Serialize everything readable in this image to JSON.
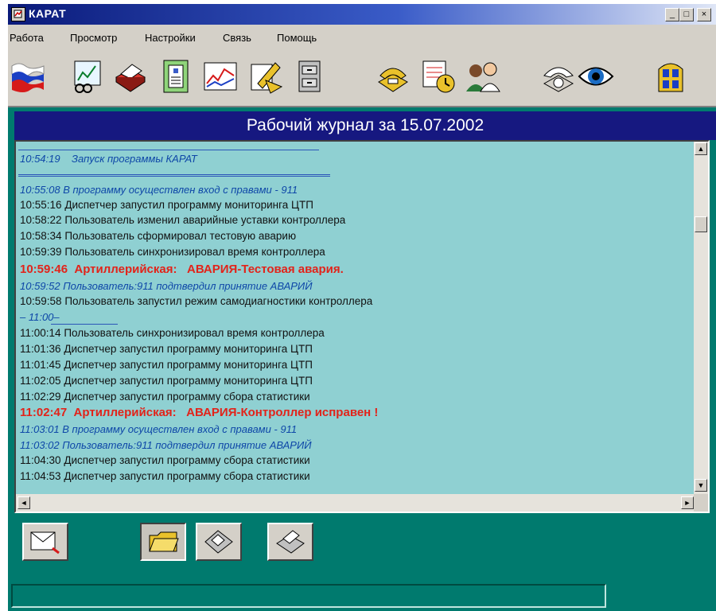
{
  "window": {
    "title": "КАРАТ",
    "min_glyph": "_",
    "max_glyph": "□",
    "close_glyph": "×"
  },
  "menu": {
    "items": [
      "Работа",
      "Просмотр",
      "Настройки",
      "Связь",
      "Помощь"
    ]
  },
  "toolbar": {
    "icons": [
      "russia-flag-icon",
      "chart-report-icon",
      "printer-icon",
      "document-icon",
      "graph-icon",
      "edit-pencil-icon",
      "file-cabinet-icon",
      "telephone-icon",
      "calendar-clock-icon",
      "users-icon",
      "rotary-phone-icon",
      "eye-icon",
      "building-icon"
    ]
  },
  "journal": {
    "title": "Рабочий журнал за 15.07.2002",
    "entries": [
      {
        "kind": "user",
        "time": "10:54:19",
        "text": "    Запуск программы КАРАТ"
      },
      {
        "kind": "user",
        "time": "10:55:08",
        "text": " В программу осуществлен вход с правами - 911"
      },
      {
        "kind": "normal",
        "time": "10:55:16",
        "text": " Диспетчер запустил программу мониторинга ЦТП"
      },
      {
        "kind": "normal",
        "time": "10:58:22",
        "text": " Пользователь изменил аварийные уставки контроллера"
      },
      {
        "kind": "normal",
        "time": "10:58:34",
        "text": " Пользователь сформировал тестовую аварию"
      },
      {
        "kind": "normal",
        "time": "10:59:39",
        "text": " Пользователь синхронизировал время контроллера"
      },
      {
        "kind": "alarm",
        "time": "10:59:46",
        "text": "  Артиллерийская:   АВАРИЯ-Тестовая авария."
      },
      {
        "kind": "user",
        "time": "10:59:52",
        "text": " Пользователь:911 подтвердил принятие АВАРИЙ"
      },
      {
        "kind": "normal",
        "time": "10:59:58",
        "text": " Пользователь запустил режим самодиагностики контроллера"
      },
      {
        "kind": "user",
        "time": "",
        "text": "– 11:00–"
      },
      {
        "kind": "normal",
        "time": "11:00:14",
        "text": " Пользователь синхронизировал время контроллера"
      },
      {
        "kind": "normal",
        "time": "11:01:36",
        "text": " Диспетчер запустил программу мониторинга ЦТП"
      },
      {
        "kind": "normal",
        "time": "11:01:45",
        "text": " Диспетчер запустил программу мониторинга ЦТП"
      },
      {
        "kind": "normal",
        "time": "11:02:05",
        "text": " Диспетчер запустил программу мониторинга ЦТП"
      },
      {
        "kind": "normal",
        "time": "11:02:29",
        "text": " Диспетчер запустил программу сбора статистики"
      },
      {
        "kind": "alarm",
        "time": "11:02:47",
        "text": "  Артиллерийская:   АВАРИЯ-Контроллер исправен !"
      },
      {
        "kind": "user",
        "time": "11:03:01",
        "text": " В программу осуществлен вход с правами - 911"
      },
      {
        "kind": "user",
        "time": "11:03:02",
        "text": " Пользователь:911 подтвердил принятие АВАРИЙ"
      },
      {
        "kind": "normal",
        "time": "11:04:30",
        "text": " Диспетчер запустил программу сбора статистики"
      },
      {
        "kind": "normal",
        "time": "11:04:53",
        "text": " Диспетчер запустил программу сбора статистики"
      }
    ]
  },
  "scroll": {
    "up": "▲",
    "down": "▼",
    "left": "◄",
    "right": "►"
  },
  "bottom_buttons": {
    "icons": [
      "mail-envelope-icon",
      "open-folder-icon",
      "floppy-disk-icon",
      "printer-icon"
    ]
  },
  "status_bar": {
    "text": ""
  },
  "colors": {
    "journal_header": "#161880",
    "log_background": "#8fd0d2",
    "alarm": "#e2231a",
    "user_action": "#0e47a8",
    "window_background": "#007a6e"
  }
}
